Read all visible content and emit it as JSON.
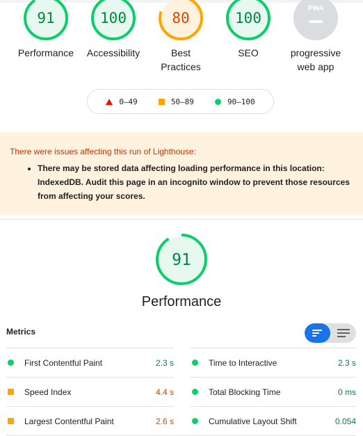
{
  "summary": {
    "categories": [
      {
        "label": "Performance",
        "score": "91",
        "status": "pass",
        "fraction": 0.91
      },
      {
        "label": "Accessibility",
        "score": "100",
        "status": "pass",
        "fraction": 1.0
      },
      {
        "label": "Best Practices",
        "score": "80",
        "status": "average",
        "fraction": 0.8
      },
      {
        "label": "SEO",
        "score": "100",
        "status": "pass",
        "fraction": 1.0
      },
      {
        "label": "progressive web app",
        "badge": "PWA",
        "status": "na"
      }
    ]
  },
  "legend": {
    "fail": "0–49",
    "average": "50–89",
    "pass": "90–100"
  },
  "warning": {
    "title": "There were issues affecting this run of Lighthouse:",
    "items": [
      "There may be stored data affecting loading performance in this location: IndexedDB. Audit this page in an incognito window to prevent those resources from affecting your scores."
    ]
  },
  "performance": {
    "score": "91",
    "fraction": 0.91,
    "title": "Performance",
    "metrics_title": "Metrics",
    "metrics": [
      {
        "name": "First Contentful Paint",
        "value": "2.3 s",
        "status": "pass"
      },
      {
        "name": "Time to Interactive",
        "value": "2.3 s",
        "status": "pass"
      },
      {
        "name": "Speed Index",
        "value": "4.4 s",
        "status": "average"
      },
      {
        "name": "Total Blocking Time",
        "value": "0 ms",
        "status": "pass"
      },
      {
        "name": "Largest Contentful Paint",
        "value": "2.6 s",
        "status": "average"
      },
      {
        "name": "Cumulative Layout Shift",
        "value": "0.054",
        "status": "pass"
      }
    ]
  },
  "colors": {
    "pass": "#0cce6b",
    "pass_text": "#018642",
    "pass_bg": "#e6f8ef",
    "average": "#ffa400",
    "average_text": "#d04900",
    "average_bg": "#fff3e0",
    "fail": "#eb0f00",
    "accent": "#1a73e8",
    "warning_bg": "#fff3e0",
    "warning_text": "#c33300"
  }
}
